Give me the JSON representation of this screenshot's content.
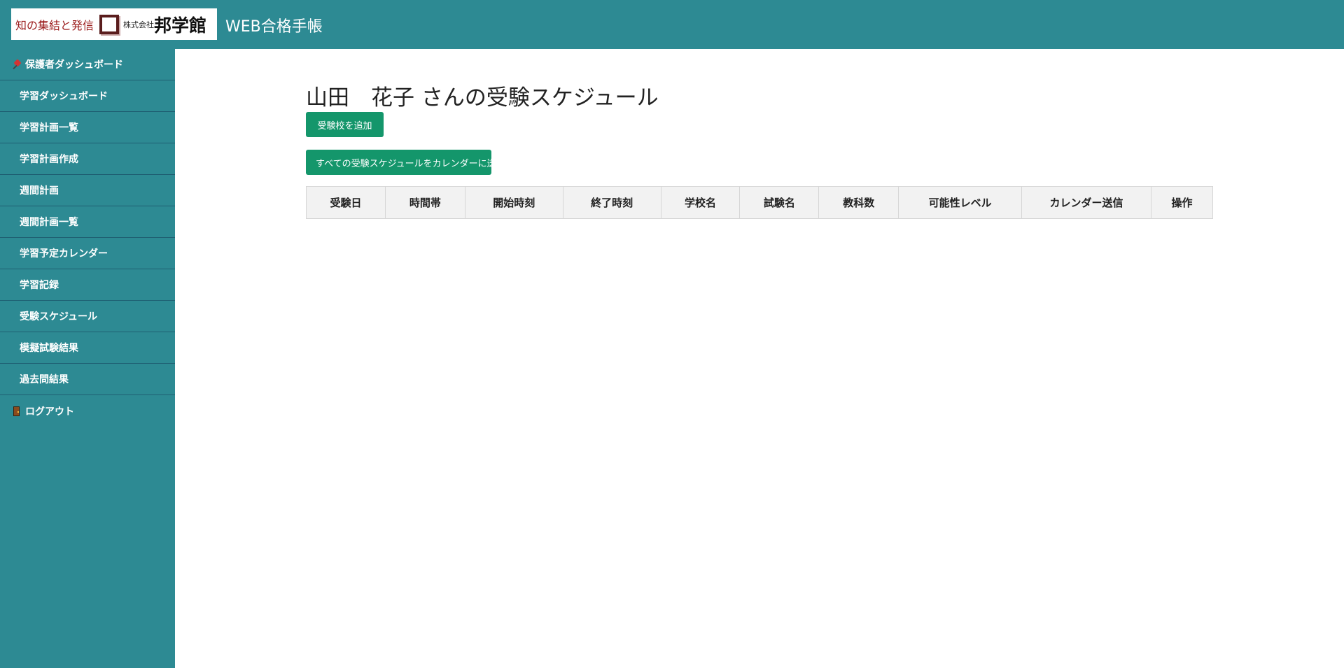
{
  "header": {
    "logo_tagline": "知の集結と発信",
    "logo_company_prefix": "株式会社",
    "logo_company_name": "邦学館",
    "app_title": "WEB合格手帳"
  },
  "sidebar": {
    "items": [
      {
        "label": "保護者ダッシュボード",
        "icon": "pin-icon"
      },
      {
        "label": "学習ダッシュボード"
      },
      {
        "label": "学習計画一覧"
      },
      {
        "label": "学習計画作成"
      },
      {
        "label": "週間計画"
      },
      {
        "label": "週間計画一覧"
      },
      {
        "label": "学習予定カレンダー"
      },
      {
        "label": "学習記録"
      },
      {
        "label": "受験スケジュール"
      },
      {
        "label": "模擬試験結果"
      },
      {
        "label": "過去問結果"
      },
      {
        "label": "ログアウト",
        "icon": "door-icon"
      }
    ]
  },
  "main": {
    "title": "山田　花子 さんの受験スケジュール",
    "add_button": "受験校を追加",
    "send_button": "すべての受験スケジュールをカレンダーに送信",
    "table": {
      "columns": [
        "受験日",
        "時間帯",
        "開始時刻",
        "終了時刻",
        "学校名",
        "試験名",
        "教科数",
        "可能性レベル",
        "カレンダー送信",
        "操作"
      ],
      "rows": []
    }
  },
  "colors": {
    "primary": "#2d8a93",
    "button": "#14966b",
    "sidebar_divider": "#1f5f72"
  }
}
